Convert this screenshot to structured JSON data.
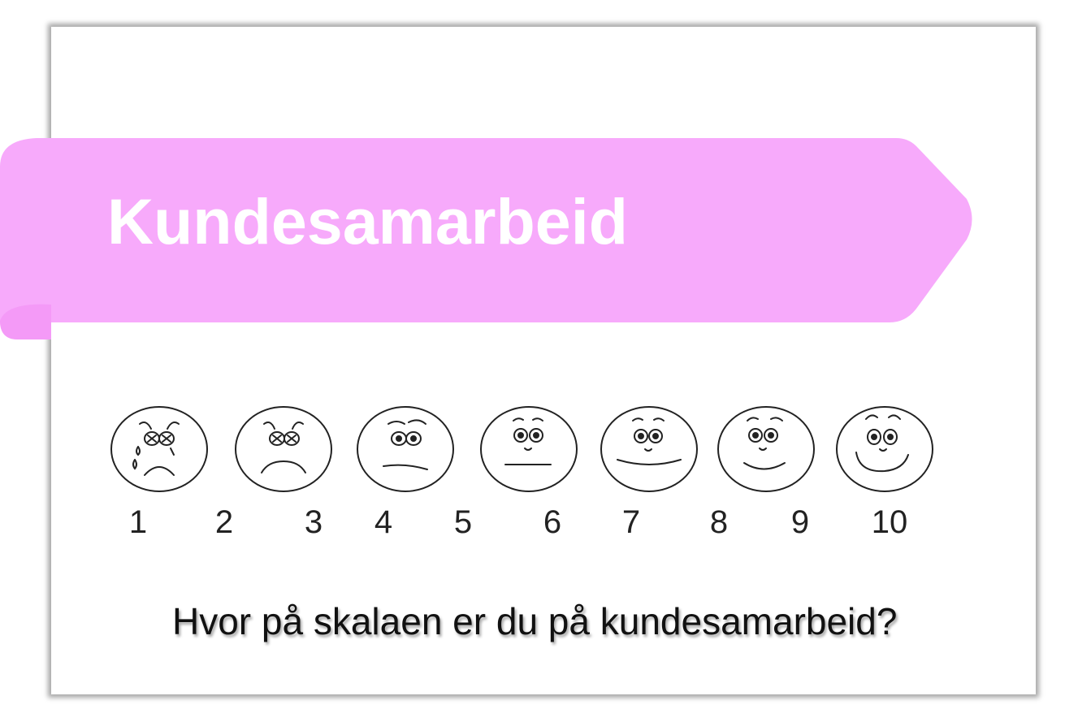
{
  "slide": {
    "title": "Kundesamarbeid",
    "question": "Hvor på skalaen er du på kundesamarbeid?",
    "ribbon_color": "#f7aafb",
    "scale": {
      "numbers": [
        "1",
        "2",
        "3",
        "4",
        "5",
        "6",
        "7",
        "8",
        "9",
        "10"
      ],
      "faces": [
        {
          "icon": "crying-face-icon"
        },
        {
          "icon": "sad-face-icon"
        },
        {
          "icon": "frowning-face-icon"
        },
        {
          "icon": "neutral-face-icon"
        },
        {
          "icon": "slight-smile-face-icon"
        },
        {
          "icon": "smiling-face-icon"
        },
        {
          "icon": "happy-face-icon"
        }
      ]
    }
  }
}
